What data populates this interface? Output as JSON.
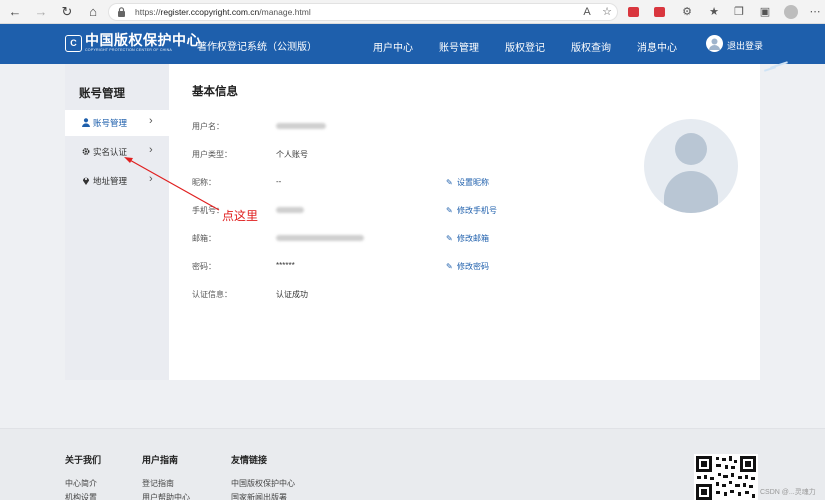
{
  "browser": {
    "url_prefix": "https://",
    "url_host": "register.ccopyright.com.cn",
    "url_path": "/manage.html",
    "back_icon": "arrow-left",
    "forward_icon": "arrow-right",
    "reload_icon": "reload",
    "home_icon": "home"
  },
  "header": {
    "logo_cn": "中国版权保护中心",
    "logo_en": "COPYRIGHT PROTECTION CENTER OF CHINA",
    "logo_mark": "C",
    "system_title": "著作权登记系统（公测版）",
    "nav": [
      "用户中心",
      "账号管理",
      "版权登记",
      "版权查询",
      "消息中心"
    ],
    "logout_label": "退出登录"
  },
  "sidebar": {
    "title": "账号管理",
    "items": [
      {
        "label": "账号管理",
        "icon": "user-icon",
        "active": true
      },
      {
        "label": "实名认证",
        "icon": "gear-icon",
        "active": false
      },
      {
        "label": "地址管理",
        "icon": "location-pin-icon",
        "active": false
      }
    ]
  },
  "basic_info": {
    "title": "基本信息",
    "rows": [
      {
        "label": "用户名：",
        "value": "",
        "blurred": true,
        "action": ""
      },
      {
        "label": "用户类型：",
        "value": "个人账号",
        "blurred": false,
        "action": ""
      },
      {
        "label": "昵称：",
        "value": "--",
        "blurred": false,
        "action": "设置昵称"
      },
      {
        "label": "手机号：",
        "value": "",
        "blurred": true,
        "action": "修改手机号"
      },
      {
        "label": "邮箱：",
        "value": "",
        "blurred": true,
        "action": "修改邮箱"
      },
      {
        "label": "密码：",
        "value": "******",
        "blurred": false,
        "action": "修改密码"
      },
      {
        "label": "认证信息：",
        "value": "认证成功",
        "blurred": false,
        "action": ""
      }
    ]
  },
  "annotation": {
    "text": "点这里",
    "color": "#e02020"
  },
  "footer": {
    "columns": [
      {
        "title": "关于我们",
        "links": [
          "中心简介",
          "机构设置"
        ]
      },
      {
        "title": "用户指南",
        "links": [
          "登记指南",
          "用户帮助中心"
        ]
      },
      {
        "title": "友情链接",
        "links": [
          "中国版权保护中心",
          "国家新闻出版署"
        ]
      }
    ],
    "watermark": "CSDN @...灵魂力"
  },
  "colors": {
    "brand_blue": "#1e5fac",
    "annotation_red": "#e02020"
  }
}
